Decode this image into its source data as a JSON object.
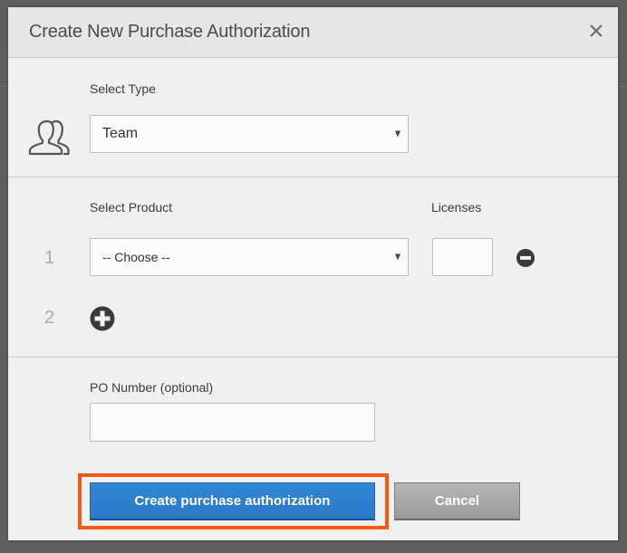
{
  "dialog": {
    "title": "Create New Purchase Authorization",
    "close_icon": "close-icon"
  },
  "type_section": {
    "label": "Select Type",
    "icon": "users-icon",
    "selected": "Team"
  },
  "product_section": {
    "product_label": "Select Product",
    "licenses_label": "Licenses",
    "rows": [
      {
        "number": "1",
        "product": "-- Choose --",
        "licenses": "",
        "remove_icon": "minus-circle-icon"
      }
    ],
    "add_row": {
      "number": "2",
      "add_icon": "plus-circle-icon"
    }
  },
  "po_section": {
    "label": "PO Number (optional)",
    "value": ""
  },
  "actions": {
    "primary_label": "Create purchase authorization",
    "cancel_label": "Cancel"
  },
  "colors": {
    "primary": "#2d7fd3",
    "highlight": "#f25a16",
    "backdrop": "#5f5f5f"
  }
}
